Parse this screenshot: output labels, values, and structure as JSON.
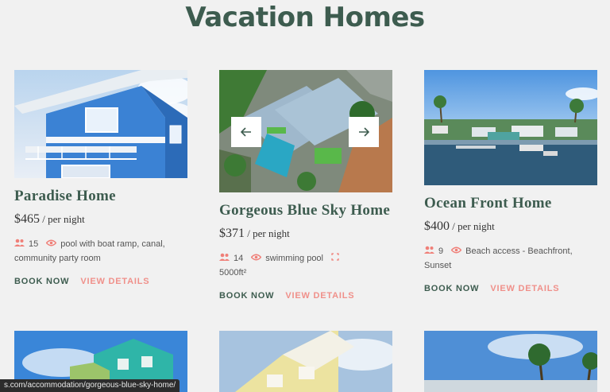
{
  "page": {
    "title": "Vacation Homes"
  },
  "listings": [
    {
      "title": "Paradise Home",
      "price": "$465",
      "per": " / per night",
      "guests": "15",
      "features": "pool with boat ramp, canal, community party room",
      "area": "",
      "book_label": "BOOK NOW",
      "details_label": "VIEW DETAILS"
    },
    {
      "title": "Gorgeous Blue Sky Home",
      "price": "$371",
      "per": " / per night",
      "guests": "14",
      "features": "swimming pool",
      "area": "5000ft²",
      "book_label": "BOOK NOW",
      "details_label": "VIEW DETAILS"
    },
    {
      "title": "Ocean Front Home",
      "price": "$400",
      "per": " / per night",
      "guests": "9",
      "features": "Beach access - Beachfront, Sunset",
      "area": "",
      "book_label": "BOOK NOW",
      "details_label": "VIEW DETAILS"
    }
  ],
  "status_bar": {
    "url": "s.com/accommodation/gorgeous-blue-sky-home/"
  },
  "colors": {
    "heading": "#3d5c4f",
    "accent": "#f0908a",
    "icon": "#f07f78"
  },
  "icons": [
    "guests-icon",
    "eye-icon",
    "area-icon",
    "arrow-left-icon",
    "arrow-right-icon"
  ]
}
